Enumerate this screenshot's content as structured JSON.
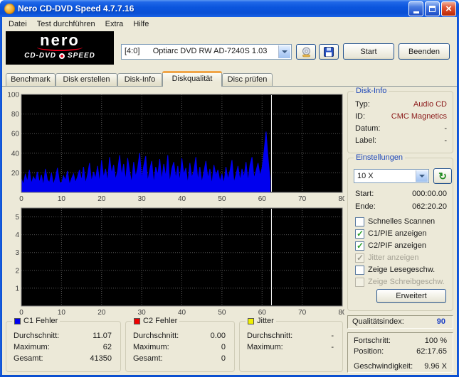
{
  "window": {
    "title": "Nero CD-DVD Speed 4.7.7.16"
  },
  "menu": {
    "items": [
      "Datei",
      "Test durchführen",
      "Extra",
      "Hilfe"
    ]
  },
  "logo": {
    "brand": "nero",
    "product_left": "CD-DVD",
    "product_right": "SPEED"
  },
  "toolbar": {
    "drive": "[4:0]      Optiarc DVD RW AD-7240S 1.03",
    "start": "Start",
    "quit": "Beenden"
  },
  "tabs": {
    "items": [
      "Benchmark",
      "Disk erstellen",
      "Disk-Info",
      "Diskqualität",
      "Disc prüfen"
    ],
    "active": "Diskqualität"
  },
  "disk_info": {
    "title": "Disk-Info",
    "rows": [
      {
        "label": "Typ:",
        "value": "Audio CD"
      },
      {
        "label": "ID:",
        "value": "CMC Magnetics"
      },
      {
        "label": "Datum:",
        "value": "-"
      },
      {
        "label": "Label:",
        "value": "-"
      }
    ]
  },
  "settings": {
    "title": "Einstellungen",
    "speed": "10 X",
    "start_label": "Start:",
    "start_value": "000:00.00",
    "end_label": "Ende:",
    "end_value": "062:20.20",
    "checkboxes": [
      {
        "label": "Schnelles Scannen",
        "checked": false,
        "enabled": true
      },
      {
        "label": "C1/PIE anzeigen",
        "checked": true,
        "enabled": true
      },
      {
        "label": "C2/PIF anzeigen",
        "checked": true,
        "enabled": true
      },
      {
        "label": "Jitter anzeigen",
        "checked": true,
        "enabled": false
      },
      {
        "label": "Zeige Lesegeschw.",
        "checked": false,
        "enabled": true
      },
      {
        "label": "Zeige Schreibgeschw.",
        "checked": false,
        "enabled": false
      }
    ],
    "advanced": "Erweitert"
  },
  "quality": {
    "label": "Qualitätsindex:",
    "value": "90"
  },
  "status": {
    "rows": [
      {
        "label": "Fortschritt:",
        "value": "100 %"
      },
      {
        "label": "Position:",
        "value": "62:17.65"
      },
      {
        "label": "Geschwindigkeit:",
        "value": "9.96 X"
      }
    ]
  },
  "stats": [
    {
      "title": "C1 Fehler",
      "color": "#0000f0",
      "rows": [
        {
          "label": "Durchschnitt:",
          "value": "11.07"
        },
        {
          "label": "Maximum:",
          "value": "62"
        },
        {
          "label": "Gesamt:",
          "value": "41350"
        }
      ]
    },
    {
      "title": "C2 Fehler",
      "color": "#f00000",
      "rows": [
        {
          "label": "Durchschnitt:",
          "value": "0.00"
        },
        {
          "label": "Maximum:",
          "value": "0"
        },
        {
          "label": "Gesamt:",
          "value": "0"
        }
      ]
    },
    {
      "title": "Jitter",
      "color": "#f0f000",
      "rows": [
        {
          "label": "Durchschnitt:",
          "value": "-"
        },
        {
          "label": "Maximum:",
          "value": "-"
        }
      ]
    }
  ],
  "colors": {
    "info_value": "#8b1a1a",
    "quality_value": "#1b3fc4"
  },
  "chart_data": [
    {
      "type": "area",
      "name": "C1 errors vs disc position (min)",
      "xlim": [
        0,
        80
      ],
      "ylim": [
        0,
        100
      ],
      "x_ticks": [
        0,
        10,
        20,
        30,
        40,
        50,
        60,
        70,
        80
      ],
      "y_ticks": [
        20,
        40,
        60,
        80,
        100
      ],
      "grid": true,
      "bg": "#000000",
      "cursor_x": 62.34,
      "series": [
        {
          "name": "C1",
          "color": "#0000ee",
          "x_step": 0.5,
          "values": [
            14,
            8,
            19,
            11,
            23,
            9,
            16,
            12,
            21,
            10,
            18,
            7,
            24,
            13,
            10,
            20,
            8,
            15,
            25,
            11,
            9,
            17,
            12,
            22,
            8,
            14,
            19,
            10,
            16,
            23,
            12,
            26,
            9,
            18,
            30,
            11,
            21,
            14,
            27,
            10,
            33,
            15,
            24,
            11,
            36,
            19,
            28,
            13,
            22,
            38,
            17,
            29,
            12,
            35,
            21,
            10,
            31,
            16,
            25,
            40,
            14,
            27,
            37,
            11,
            23,
            32,
            9,
            26,
            18,
            34,
            12,
            29,
            16,
            38,
            10,
            24,
            31,
            14,
            27,
            11,
            35,
            18,
            25,
            9,
            30,
            15,
            22,
            36,
            12,
            26,
            10,
            21,
            32,
            14,
            24,
            8,
            28,
            17,
            23,
            11,
            19,
            9,
            26,
            13,
            22,
            33,
            10,
            18,
            27,
            12,
            24,
            15,
            31,
            11,
            28,
            36,
            14,
            22,
            30,
            17,
            25,
            42,
            62,
            35,
            12
          ]
        }
      ]
    },
    {
      "type": "area",
      "name": "C2 errors vs disc position (min)",
      "xlim": [
        0,
        80
      ],
      "ylim": [
        0,
        5.5
      ],
      "x_ticks": [
        0,
        10,
        20,
        30,
        40,
        50,
        60,
        70,
        80
      ],
      "y_ticks": [
        1,
        2,
        3,
        4,
        5
      ],
      "grid": true,
      "bg": "#000000",
      "cursor_x": 62.34,
      "series": [
        {
          "name": "C2",
          "color": "#f00000",
          "x_step": 0.5,
          "values": []
        }
      ]
    }
  ]
}
